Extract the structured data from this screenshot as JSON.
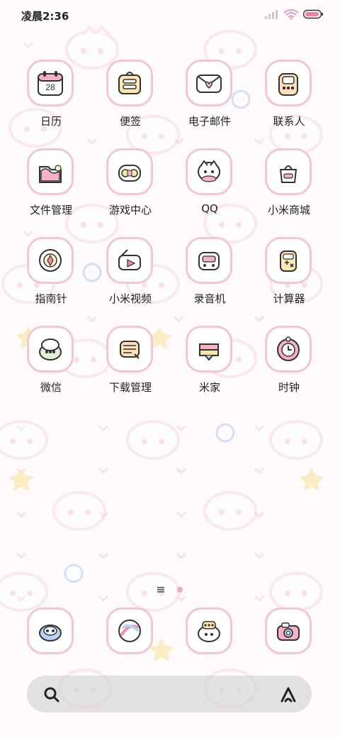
{
  "status_bar": {
    "time": "凌晨2:36",
    "icons": [
      "signal-icon",
      "wifi-icon",
      "battery-icon"
    ]
  },
  "apps": [
    {
      "label": "日历",
      "icon": "calendar-icon",
      "badge_text": "28"
    },
    {
      "label": "便签",
      "icon": "notes-icon"
    },
    {
      "label": "电子邮件",
      "icon": "email-icon"
    },
    {
      "label": "联系人",
      "icon": "contacts-icon"
    },
    {
      "label": "文件管理",
      "icon": "folder-icon"
    },
    {
      "label": "游戏中心",
      "icon": "gamepad-icon"
    },
    {
      "label": "QQ",
      "icon": "qq-icon"
    },
    {
      "label": "小米商城",
      "icon": "shopping-bag-icon"
    },
    {
      "label": "指南针",
      "icon": "compass-icon"
    },
    {
      "label": "小米视频",
      "icon": "video-icon"
    },
    {
      "label": "录音机",
      "icon": "recorder-icon"
    },
    {
      "label": "计算器",
      "icon": "calculator-icon"
    },
    {
      "label": "微信",
      "icon": "wechat-icon"
    },
    {
      "label": "下载管理",
      "icon": "download-icon"
    },
    {
      "label": "米家",
      "icon": "mijia-icon"
    },
    {
      "label": "时钟",
      "icon": "clock-icon"
    }
  ],
  "dock": [
    {
      "icon": "phone-icon"
    },
    {
      "icon": "browser-icon"
    },
    {
      "icon": "messages-icon"
    },
    {
      "icon": "camera-icon"
    }
  ],
  "search_bar": {
    "left_icon": "search-icon",
    "right_icon": "assistant-icon"
  },
  "colors": {
    "tile_border": "#f4c6d0",
    "wallpaper_bg": "#fffafb",
    "heart": "#f7cfd8",
    "accent_pink": "#f08ca6",
    "blue": "#b7d3f3",
    "yellow": "#f7e6a6"
  }
}
